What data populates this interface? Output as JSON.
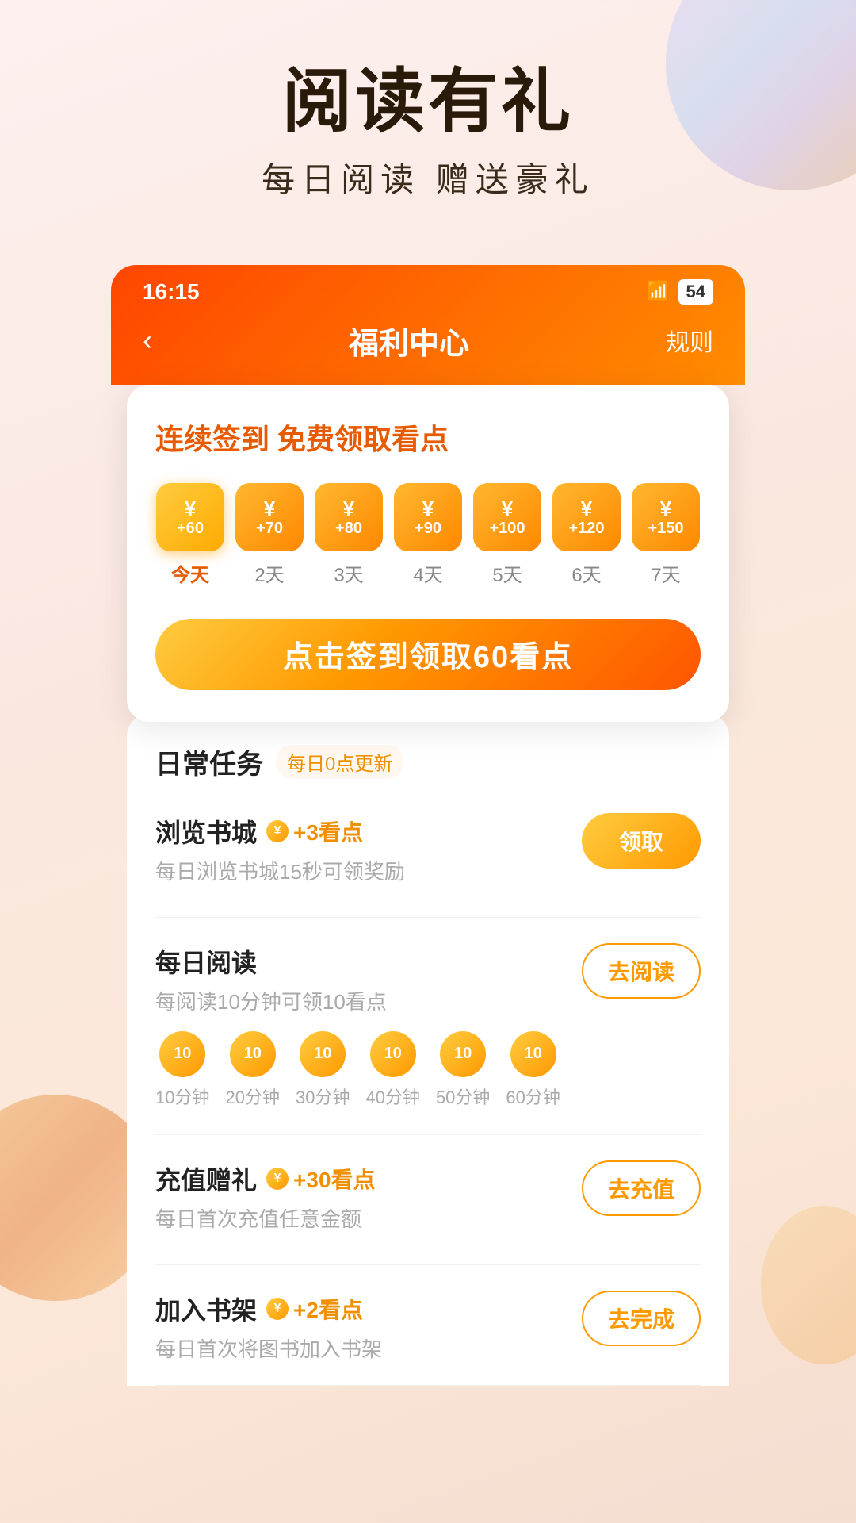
{
  "hero": {
    "title": "阅读有礼",
    "subtitle": "每日阅读  赠送豪礼"
  },
  "statusBar": {
    "time": "16:15",
    "battery": "54"
  },
  "navBar": {
    "back": "‹",
    "title": "福利中心",
    "rule": "规则"
  },
  "signinCard": {
    "title": "连续签到 免费领取看点",
    "days": [
      {
        "amount": "+60",
        "label": "今天",
        "today": true
      },
      {
        "amount": "+70",
        "label": "2天",
        "today": false
      },
      {
        "amount": "+80",
        "label": "3天",
        "today": false
      },
      {
        "amount": "+90",
        "label": "4天",
        "today": false
      },
      {
        "amount": "+100",
        "label": "5天",
        "today": false
      },
      {
        "amount": "+120",
        "label": "6天",
        "today": false
      },
      {
        "amount": "+150",
        "label": "7天",
        "today": false
      }
    ],
    "buttonText": "点击签到领取60看点"
  },
  "dailyTasks": {
    "title": "日常任务",
    "updateNote": "每日0点更新",
    "tasks": [
      {
        "name": "浏览书城",
        "rewardIcon": "¥",
        "reward": "+3看点",
        "desc": "每日浏览书城15秒可领奖励",
        "buttonText": "领取",
        "buttonFilled": true
      },
      {
        "name": "每日阅读",
        "rewardIcon": "",
        "reward": "",
        "desc": "每阅读10分钟可领10看点",
        "buttonText": "去阅读",
        "buttonFilled": false,
        "progress": [
          {
            "amount": "10",
            "label": "10分钟"
          },
          {
            "amount": "10",
            "label": "20分钟"
          },
          {
            "amount": "10",
            "label": "30分钟"
          },
          {
            "amount": "10",
            "label": "40分钟"
          },
          {
            "amount": "10",
            "label": "50分钟"
          },
          {
            "amount": "10",
            "label": "60分钟"
          }
        ]
      },
      {
        "name": "充值赠礼",
        "rewardIcon": "¥",
        "reward": "+30看点",
        "desc": "每日首次充值任意金额",
        "buttonText": "去充值",
        "buttonFilled": false
      },
      {
        "name": "加入书架",
        "rewardIcon": "¥",
        "reward": "+2看点",
        "desc": "每日首次将图书加入书架",
        "buttonText": "去完成",
        "buttonFilled": false
      }
    ]
  }
}
